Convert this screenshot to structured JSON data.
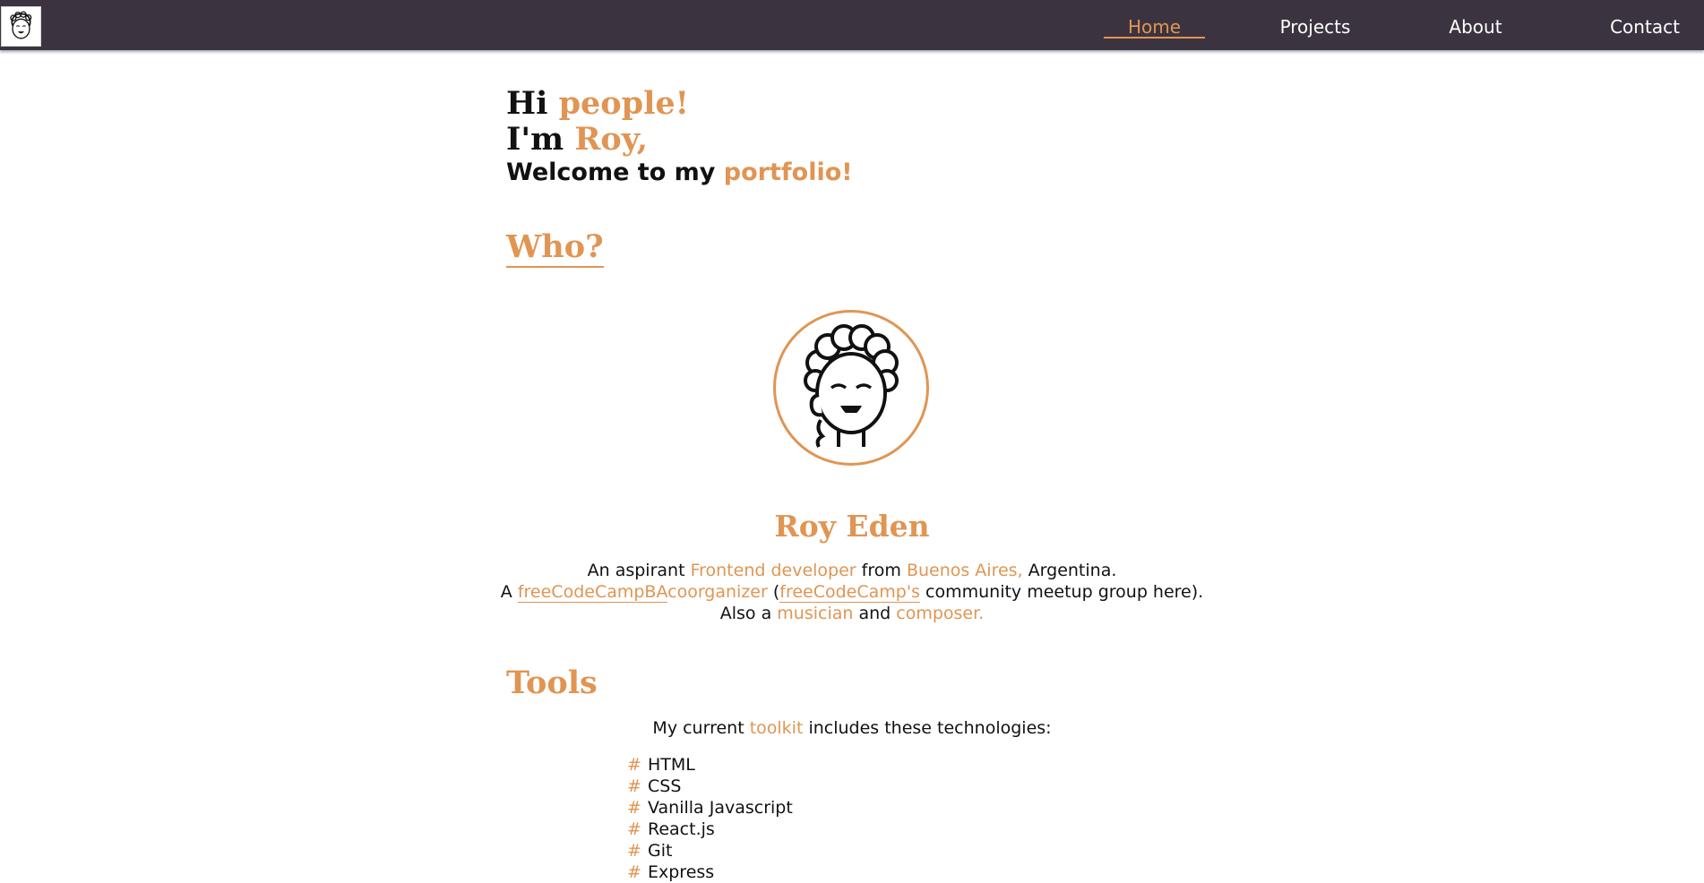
{
  "nav": {
    "logo_icon": "avatar-logo-icon",
    "links": [
      {
        "label": "Home",
        "active": true
      },
      {
        "label": "Projects",
        "active": false
      },
      {
        "label": "About",
        "active": false
      },
      {
        "label": "Contact",
        "active": false
      }
    ]
  },
  "intro": {
    "line1_a": "Hi",
    "line1_b": "people!",
    "line2_a": "I'm",
    "line2_b": "Roy,",
    "line3_a": "Welcome to my",
    "line3_b": "portfolio!"
  },
  "who": {
    "title": "Who?",
    "avatar_icon": "cartoon-avatar-icon",
    "name": "Roy Eden",
    "bio": {
      "l1_a": "An aspirant",
      "l1_b": "Frontend developer",
      "l1_c": "from",
      "l1_d": "Buenos Aires,",
      "l1_e": "Argentina.",
      "l2_a": "A",
      "l2_link1": "freeCodeCampBA",
      "l2_b": "coorganizer",
      "l2_c": "(",
      "l2_link2": "freeCodeCamp's",
      "l2_d": "community meetup group here).",
      "l3_a": "Also a",
      "l3_b": "musician",
      "l3_c": "and",
      "l3_d": "composer."
    }
  },
  "tools": {
    "title": "Tools",
    "intro_a": "My current",
    "intro_b": "toolkit",
    "intro_c": "includes these technologies:",
    "bullet": "#",
    "items": [
      "HTML",
      "CSS",
      "Vanilla Javascript",
      "React.js",
      "Git",
      "Express"
    ]
  },
  "colors": {
    "accent": "#e09553",
    "navbar_bg": "#3b3440",
    "text": "#111111"
  }
}
